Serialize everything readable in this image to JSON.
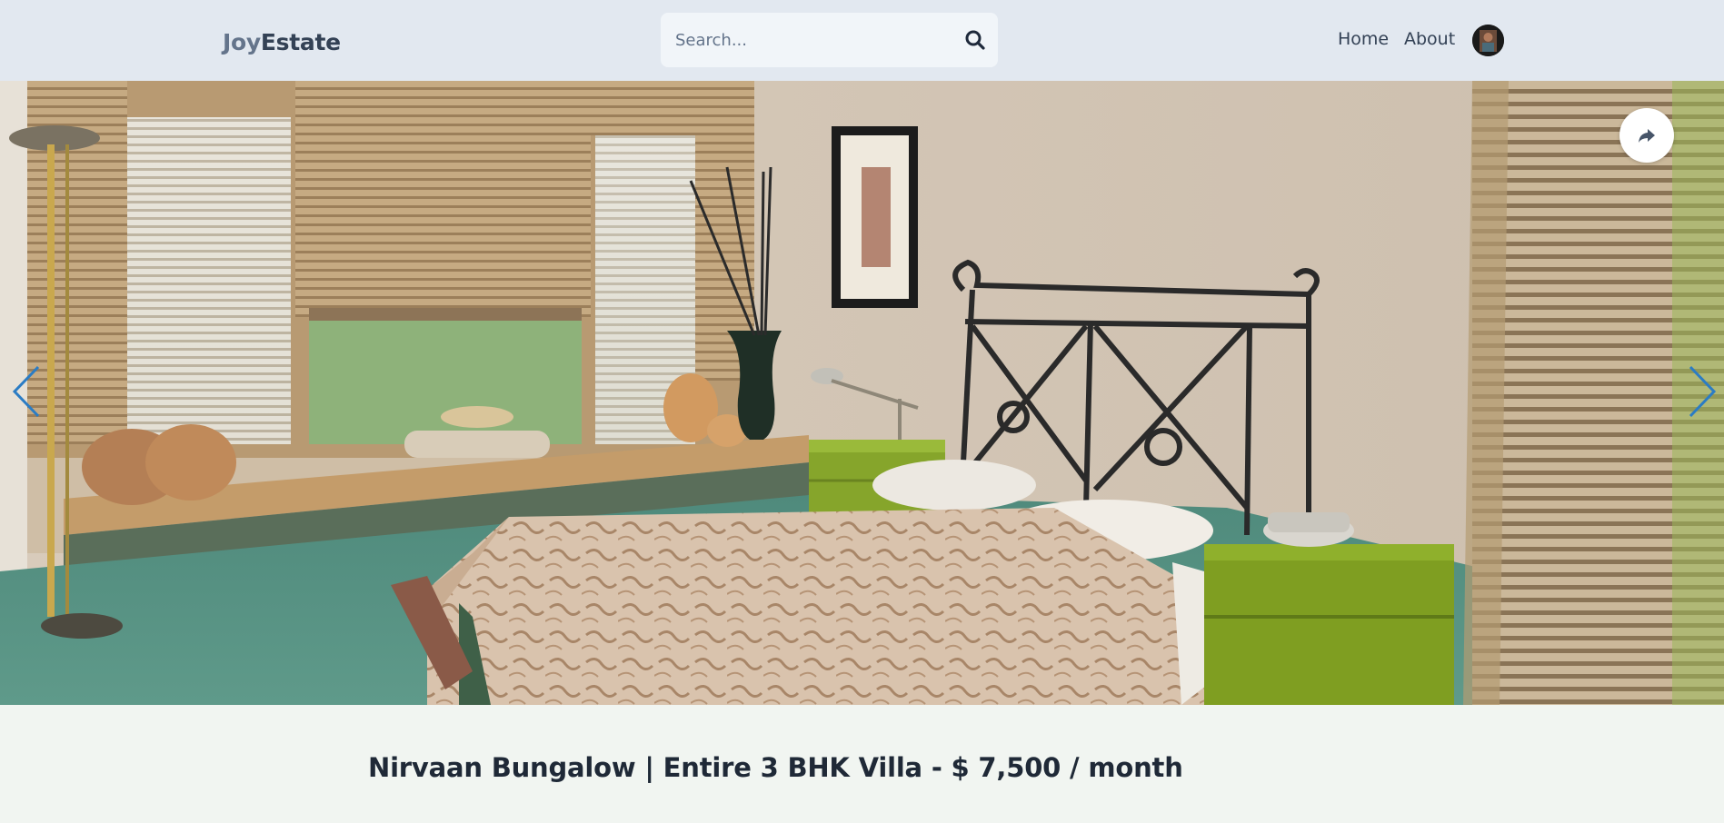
{
  "header": {
    "logo_part1": "Joy",
    "logo_part2": "Estate",
    "search_placeholder": "Search...",
    "search_icon": "search-icon",
    "nav": [
      {
        "label": "Home"
      },
      {
        "label": "About"
      }
    ],
    "avatar_icon": "user-avatar"
  },
  "hero": {
    "share_icon": "share-icon",
    "prev_icon": "chevron-left-icon",
    "next_icon": "chevron-right-icon",
    "accent_color": "#2b7cc4"
  },
  "listing": {
    "title": "Nirvaan Bungalow | Entire 3 BHK Villa - $ 7,500 / month"
  }
}
